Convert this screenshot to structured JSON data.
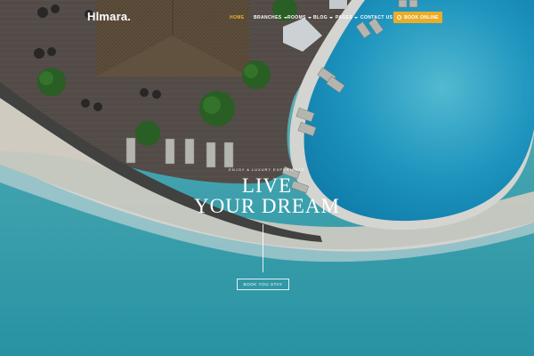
{
  "brand": {
    "logo": "Hlmara."
  },
  "nav": {
    "items": [
      {
        "label": "HOME",
        "active": true,
        "has_dropdown": false
      },
      {
        "label": "BRANCHES",
        "active": false,
        "has_dropdown": true
      },
      {
        "label": "ROOMS",
        "active": false,
        "has_dropdown": true
      },
      {
        "label": "BLOG",
        "active": false,
        "has_dropdown": true
      },
      {
        "label": "PAGES",
        "active": false,
        "has_dropdown": true
      },
      {
        "label": "CONTACT US",
        "active": false,
        "has_dropdown": false
      }
    ],
    "cta": {
      "label": "BOOK ONLINE",
      "icon": "bell-icon"
    }
  },
  "hero": {
    "subtitle": "ENJOY A LUXURY EXPERIENCE",
    "title_line1": "LIVE",
    "title_line2": "YOUR DREAM",
    "cta_label": "BOOK YOU STAY"
  },
  "colors": {
    "accent": "#e9ad2a",
    "active_nav": "#f0b22e",
    "ocean": "#3fb2c3",
    "pool": "#23a9d6",
    "deck": "#5e5550",
    "sand": "#e8e3d6"
  }
}
